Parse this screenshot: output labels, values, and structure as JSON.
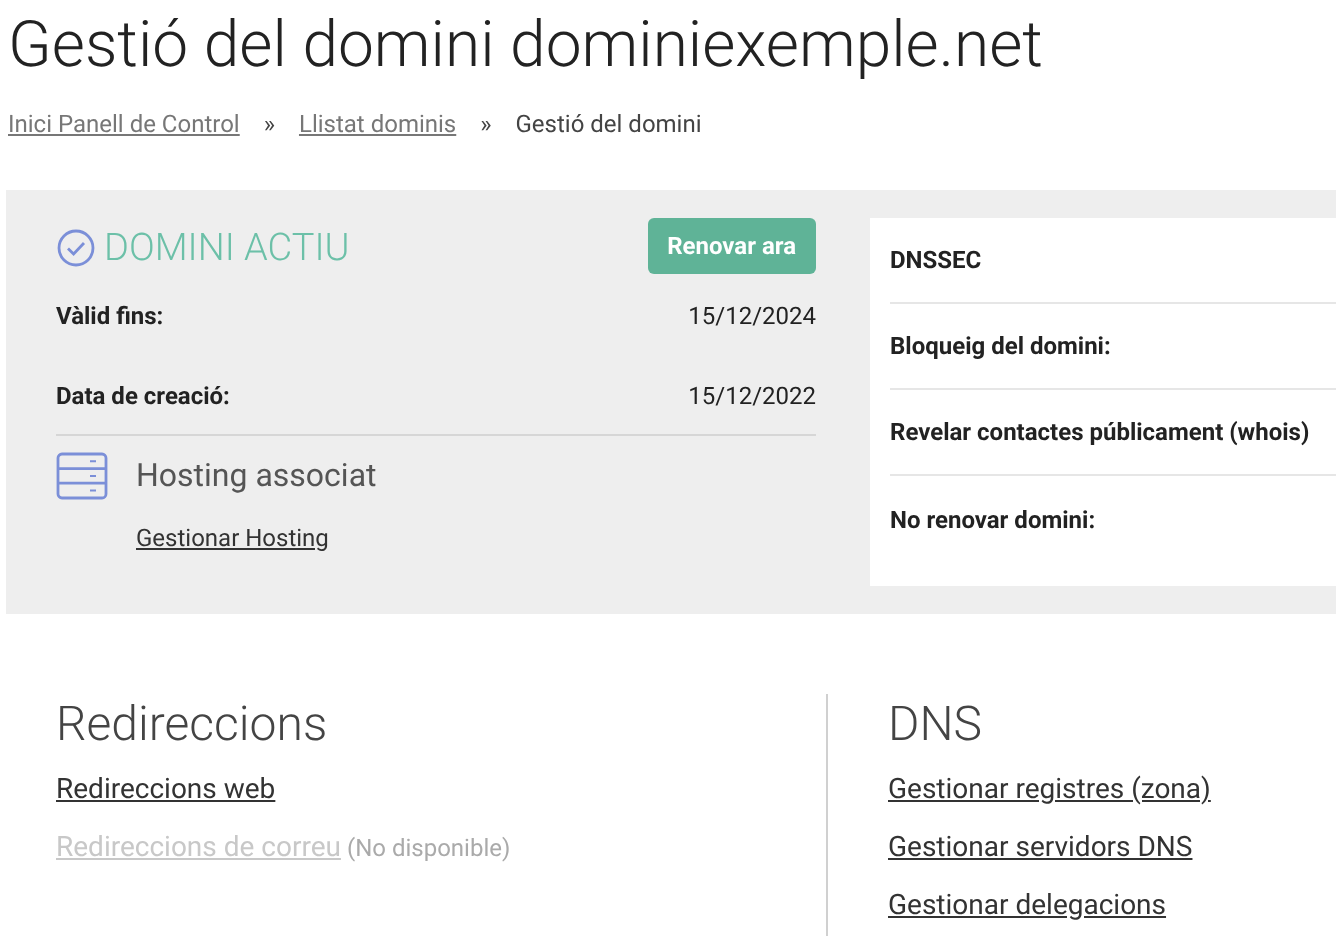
{
  "title": "Gestió del domini dominiexemple.net",
  "breadcrumb": [
    {
      "label": "Inici Panell de Control",
      "link": true
    },
    {
      "label": "»",
      "link": false
    },
    {
      "label": "Llistat dominis",
      "link": true
    },
    {
      "label": "»",
      "link": false
    },
    {
      "label": "Gestió del domini",
      "link": false
    }
  ],
  "status": {
    "label": "DOMINI ACTIU",
    "button": "Renovar ara"
  },
  "dates": [
    {
      "label": "Vàlid fins:",
      "value": "15/12/2024"
    },
    {
      "label": "Data de creació:",
      "value": "15/12/2022"
    }
  ],
  "hosting": {
    "title": "Hosting associat",
    "link": "Gestionar Hosting"
  },
  "settings": [
    {
      "label": "DNSSEC"
    },
    {
      "label": "Bloqueig del domini:"
    },
    {
      "label": "Revelar contactes públicament (whois)"
    },
    {
      "label": "No renovar domini:"
    }
  ],
  "sections": [
    {
      "title": "Redireccions",
      "links": [
        {
          "label": "Redireccions web",
          "disabled": false
        },
        {
          "label": "Redireccions de correu",
          "disabled": true,
          "note": "(No disponible)"
        }
      ]
    },
    {
      "title": "DNS",
      "links": [
        {
          "label": "Gestionar registres (zona)",
          "disabled": false
        },
        {
          "label": "Gestionar servidors DNS",
          "disabled": false
        },
        {
          "label": "Gestionar delegacions",
          "disabled": false
        }
      ]
    }
  ]
}
